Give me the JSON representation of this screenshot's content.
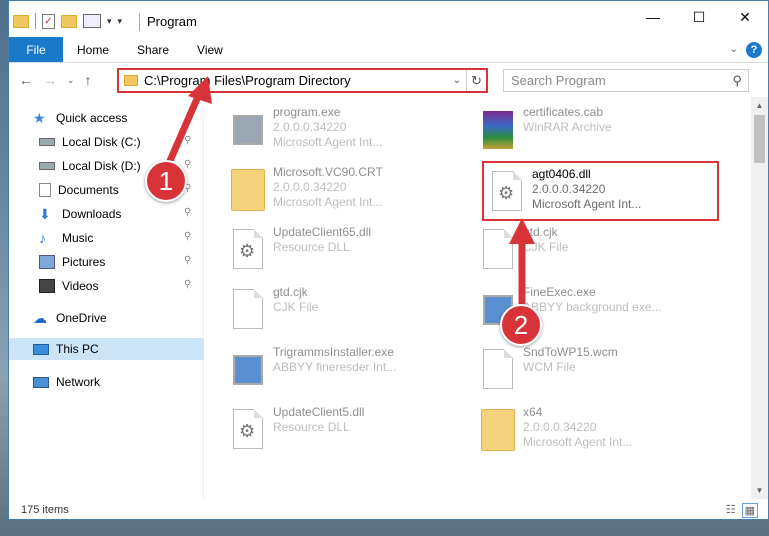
{
  "window": {
    "title": "Program",
    "controls": {
      "minimize": "—",
      "maximize": "☐",
      "close": "✕"
    }
  },
  "ribbon": {
    "tabs": [
      "File",
      "Home",
      "Share",
      "View"
    ],
    "help": "?"
  },
  "address": {
    "path": "C:\\Program Files\\Program Directory",
    "search_placeholder": "Search Program"
  },
  "sidebar": {
    "items": [
      {
        "label": "Quick access",
        "icon": "star-icon"
      },
      {
        "label": "Local Disk (C:)",
        "icon": "drive-icon",
        "pinned": true
      },
      {
        "label": "Local Disk (D:)",
        "icon": "drive-icon",
        "pinned": true
      },
      {
        "label": "Documents",
        "icon": "documents-icon",
        "pinned": true
      },
      {
        "label": "Downloads",
        "icon": "download-icon",
        "pinned": true
      },
      {
        "label": "Music",
        "icon": "music-icon",
        "pinned": true
      },
      {
        "label": "Pictures",
        "icon": "pictures-icon",
        "pinned": true
      },
      {
        "label": "Videos",
        "icon": "videos-icon",
        "pinned": true
      },
      {
        "label": "OneDrive",
        "icon": "cloud-icon"
      },
      {
        "label": "This PC",
        "icon": "computer-icon",
        "selected": true
      },
      {
        "label": "Network",
        "icon": "network-icon"
      }
    ]
  },
  "files": [
    {
      "name": "program.exe",
      "line2": "2.0.0.0.34220",
      "line3": "Microsoft Agent Int...",
      "kind": "exe"
    },
    {
      "name": "certificates.cab",
      "line2": "WinRAR Archive",
      "line3": "",
      "kind": "rar"
    },
    {
      "name": "Microsoft.VC90.CRT",
      "line2": "2.0.0.0.34220",
      "line3": "Microsoft Agent Int...",
      "kind": "folder"
    },
    {
      "name": "agt0406.dll",
      "line2": "2.0.0.0.34220",
      "line3": "Microsoft Agent Int...",
      "kind": "dll",
      "highlighted": true
    },
    {
      "name": "UpdateClient65.dll",
      "line2": "Resource DLL",
      "line3": "",
      "kind": "dll"
    },
    {
      "name": "gtd.cjk",
      "line2": "CJK File",
      "line3": "",
      "kind": "doc"
    },
    {
      "name": "gtd.cjk",
      "line2": "CJK File",
      "line3": "",
      "kind": "doc"
    },
    {
      "name": "FineExec.exe",
      "line2": "ABBYY background exe...",
      "line3": "",
      "kind": "exe"
    },
    {
      "name": "TrigrammsInstaller.exe",
      "line2": "ABBYY fineresder Int...",
      "line3": "",
      "kind": "exe"
    },
    {
      "name": "SndToWP15.wcm",
      "line2": "WCM File",
      "line3": "",
      "kind": "doc"
    },
    {
      "name": "UpdateClient5.dll",
      "line2": "Resource DLL",
      "line3": "",
      "kind": "dll"
    },
    {
      "name": "x64",
      "line2": "2.0.0.0.34220",
      "line3": "Microsoft Agent Int...",
      "kind": "folder"
    }
  ],
  "status": {
    "count": "175 items"
  },
  "annotations": {
    "step1": "1",
    "step2": "2",
    "color": "#d9333a"
  }
}
